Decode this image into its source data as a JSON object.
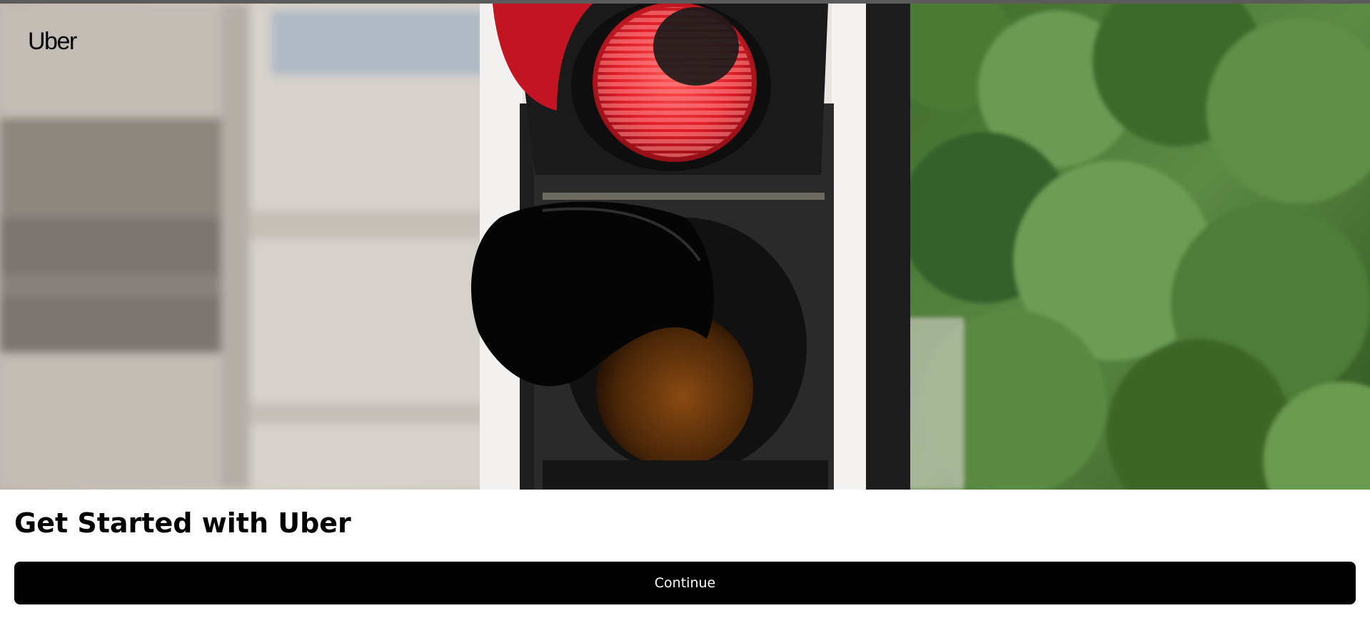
{
  "brand": {
    "logo_text": "Uber"
  },
  "hero": {
    "image_subject": "traffic-light-photo"
  },
  "main": {
    "heading": "Get Started with Uber",
    "continue_label": "Continue"
  },
  "colors": {
    "primary_button_bg": "#000000",
    "primary_button_text": "#ffffff",
    "heading_text": "#000000",
    "page_bg": "#ffffff"
  }
}
